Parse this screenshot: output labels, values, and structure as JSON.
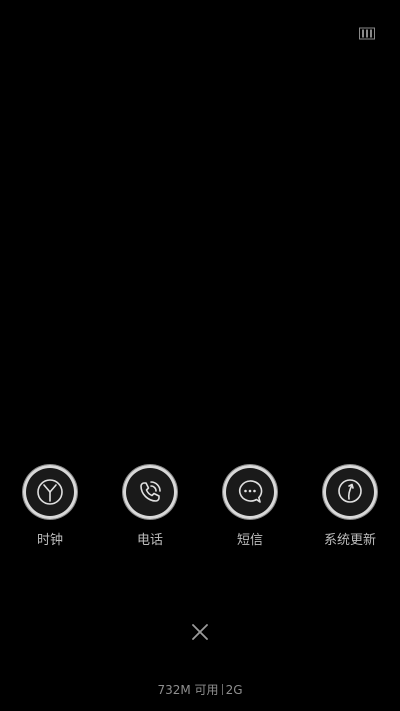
{
  "top_bar": {
    "icon": "card-icon"
  },
  "apps": [
    {
      "id": "clock",
      "label": "时钟",
      "icon": "clock-icon"
    },
    {
      "id": "phone",
      "label": "电话",
      "icon": "phone-icon"
    },
    {
      "id": "messages",
      "label": "短信",
      "icon": "message-icon"
    },
    {
      "id": "system-update",
      "label": "系统更新",
      "icon": "update-icon"
    }
  ],
  "close_button": {
    "icon": "close-icon"
  },
  "memory": {
    "available": "732M 可用",
    "network": "2G"
  },
  "colors": {
    "background": "#000000",
    "ring": "#d9d9d9",
    "label": "#bdbdbd",
    "muted": "#8f8f8f"
  }
}
